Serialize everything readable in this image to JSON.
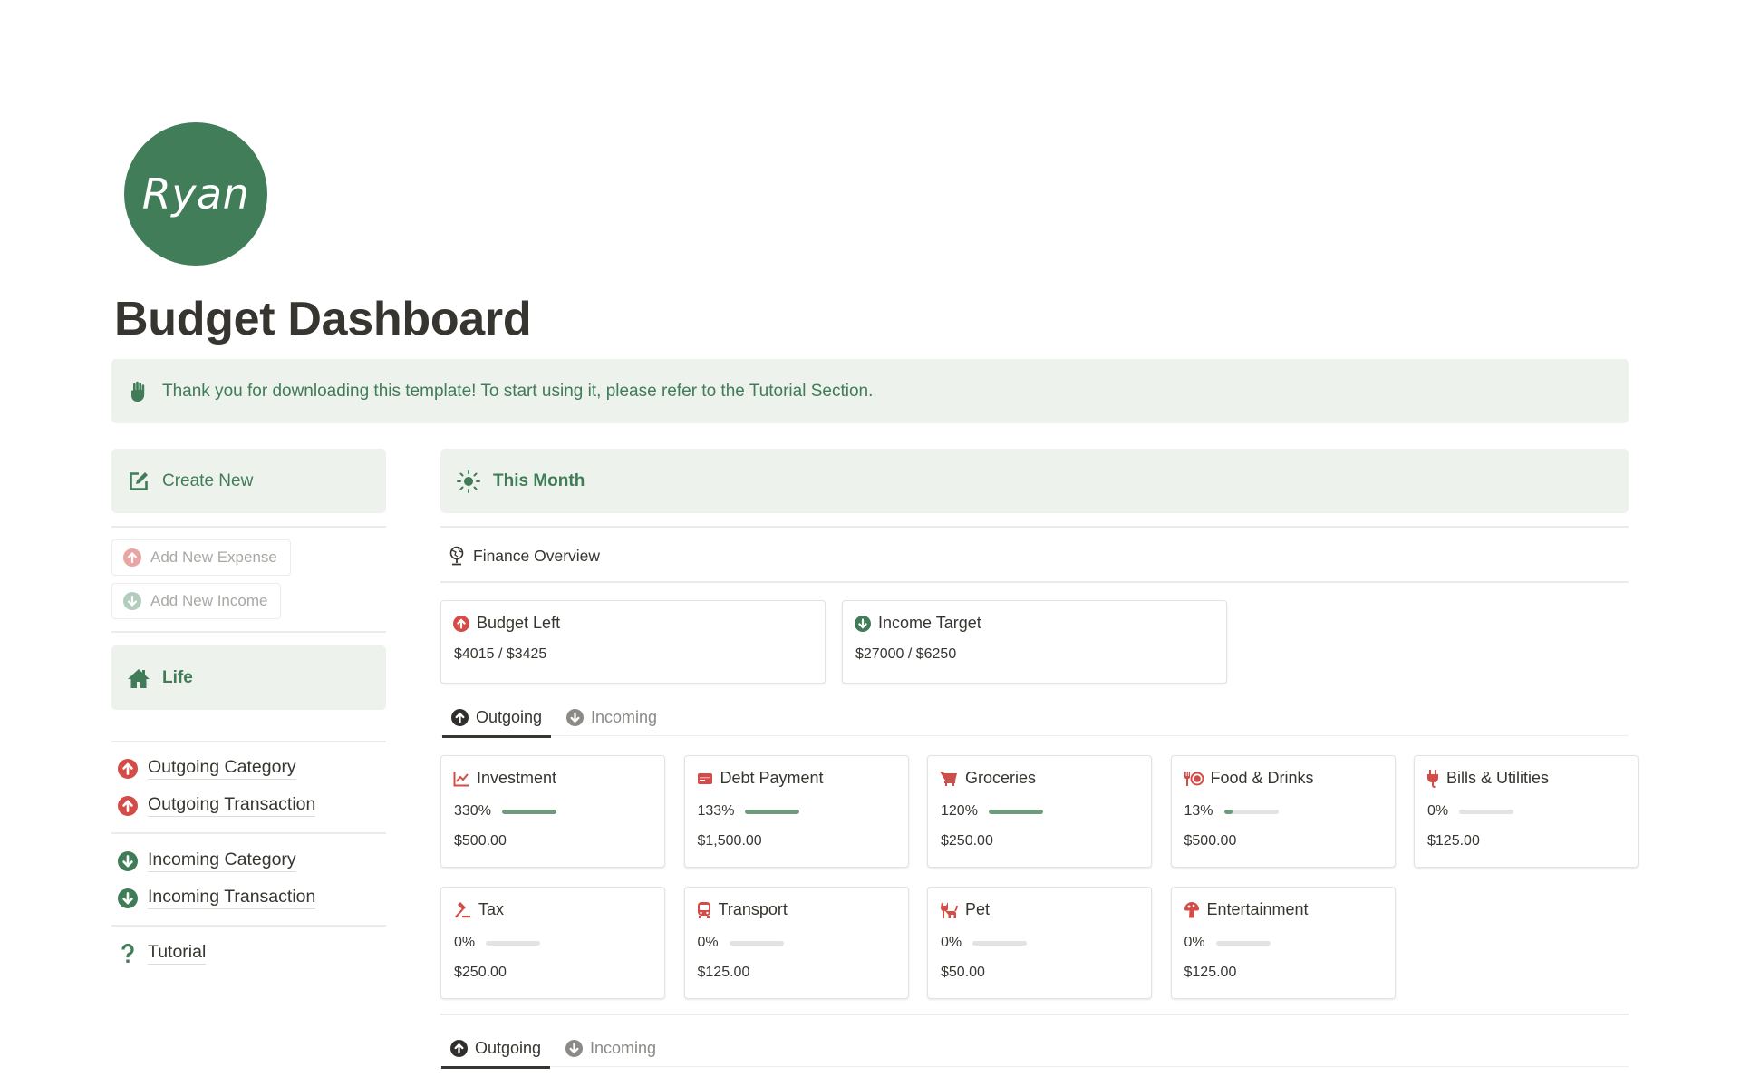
{
  "avatar": {
    "text": "Ryan",
    "color": "#417d58"
  },
  "page": {
    "title": "Budget Dashboard"
  },
  "banner": {
    "icon": "hand-icon",
    "text": "Thank you for downloading this template! To start using it, please refer to the Tutorial Section."
  },
  "sidebar": {
    "create_new": {
      "icon": "edit-icon",
      "label": "Create New"
    },
    "buttons": [
      {
        "icon": "arrow-up-circle-icon",
        "label": "Add New Expense"
      },
      {
        "icon": "arrow-down-circle-icon",
        "label": "Add New Income"
      }
    ],
    "life": {
      "icon": "home-icon",
      "label": "Life"
    },
    "links": [
      {
        "icon": "arrow-up-circle-icon",
        "label": "Outgoing Category"
      },
      {
        "icon": "arrow-up-circle-icon",
        "label": "Outgoing Transaction"
      },
      {
        "icon": "arrow-down-circle-icon",
        "label": "Incoming Category"
      },
      {
        "icon": "arrow-down-circle-icon",
        "label": "Incoming Transaction"
      },
      {
        "icon": "question-icon",
        "label": "Tutorial"
      }
    ]
  },
  "main": {
    "this_month": {
      "icon": "sun-icon",
      "label": "This Month"
    },
    "finance_overview": {
      "icon": "globe-icon",
      "label": "Finance Overview"
    },
    "overview_cards": [
      {
        "icon": "arrow-up-circle-icon",
        "title": "Budget Left",
        "value": "$4015 / $3425"
      },
      {
        "icon": "arrow-down-circle-icon",
        "title": "Income Target",
        "value": "$27000 / $6250"
      }
    ],
    "tabs": [
      {
        "label": "Outgoing",
        "active": true
      },
      {
        "label": "Incoming",
        "active": false
      }
    ],
    "categories": [
      {
        "icon": "chart-line-icon",
        "name": "Investment",
        "percent_label": "330%",
        "progress": 1.0,
        "amount": "$500.00"
      },
      {
        "icon": "credit-card-icon",
        "name": "Debt Payment",
        "percent_label": "133%",
        "progress": 1.0,
        "amount": "$1,500.00"
      },
      {
        "icon": "cart-icon",
        "name": "Groceries",
        "percent_label": "120%",
        "progress": 1.0,
        "amount": "$250.00"
      },
      {
        "icon": "fork-plate-icon",
        "name": "Food & Drinks",
        "percent_label": "13%",
        "progress": 0.13,
        "amount": "$500.00"
      },
      {
        "icon": "plug-icon",
        "name": "Bills & Utilities",
        "percent_label": "0%",
        "progress": 0,
        "amount": "$125.00"
      },
      {
        "icon": "gavel-icon",
        "name": "Tax",
        "percent_label": "0%",
        "progress": 0,
        "amount": "$250.00"
      },
      {
        "icon": "bus-icon",
        "name": "Transport",
        "percent_label": "0%",
        "progress": 0,
        "amount": "$125.00"
      },
      {
        "icon": "cat-icon",
        "name": "Pet",
        "percent_label": "0%",
        "progress": 0,
        "amount": "$50.00"
      },
      {
        "icon": "mushroom-icon",
        "name": "Entertainment",
        "percent_label": "0%",
        "progress": 0,
        "amount": "$125.00"
      }
    ],
    "bottom_tabs": [
      {
        "label": "Outgoing",
        "active": true
      },
      {
        "label": "Incoming",
        "active": false
      }
    ]
  },
  "colors": {
    "accent_green": "#3f7c57",
    "callout_bg": "#edf2ec",
    "outgoing_red": "#d44c47",
    "progress_fill": "#6c9a7b"
  }
}
